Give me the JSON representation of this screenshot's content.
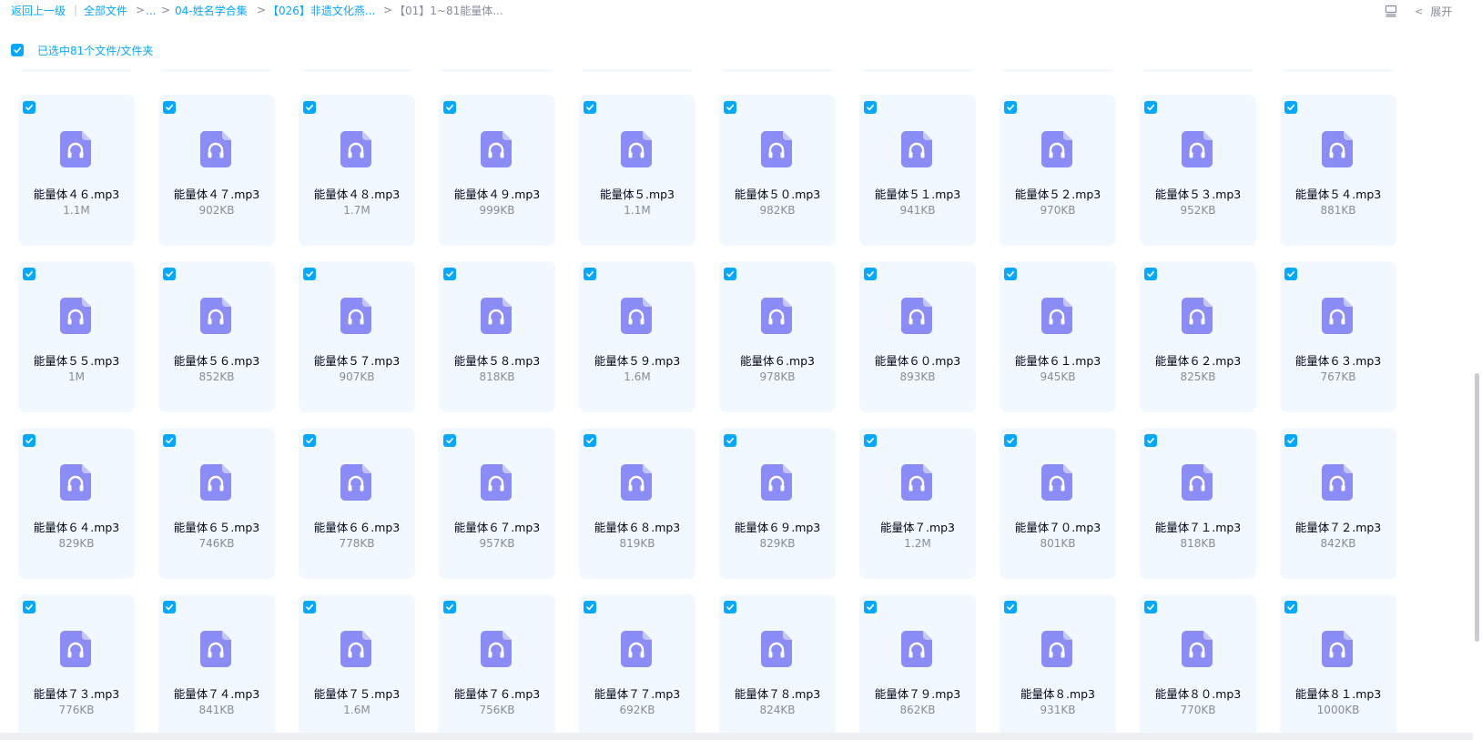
{
  "colors": {
    "accent": "#06a7ff",
    "icon": "#8b8cf6",
    "card": "#f1f8ff"
  },
  "breadcrumb": {
    "back": "返回上一级",
    "items": [
      "全部文件",
      "...",
      "04-姓名学合集",
      "【026】非遗文化燕...",
      "【01】1~81能量体..."
    ]
  },
  "toolbar": {
    "list_icon": "list-view-icon",
    "expand_label": "展开"
  },
  "selection": {
    "checked": true,
    "text": "已选中81个文件/文件夹"
  },
  "files": [
    {
      "name": "能量体４６.mp3",
      "size": "1.1M"
    },
    {
      "name": "能量体４７.mp3",
      "size": "902KB"
    },
    {
      "name": "能量体４８.mp3",
      "size": "1.7M"
    },
    {
      "name": "能量体４９.mp3",
      "size": "999KB"
    },
    {
      "name": "能量体５.mp3",
      "size": "1.1M"
    },
    {
      "name": "能量体５０.mp3",
      "size": "982KB"
    },
    {
      "name": "能量体５１.mp3",
      "size": "941KB"
    },
    {
      "name": "能量体５２.mp3",
      "size": "970KB"
    },
    {
      "name": "能量体５３.mp3",
      "size": "952KB"
    },
    {
      "name": "能量体５４.mp3",
      "size": "881KB"
    },
    {
      "name": "能量体５５.mp3",
      "size": "1M"
    },
    {
      "name": "能量体５６.mp3",
      "size": "852KB"
    },
    {
      "name": "能量体５７.mp3",
      "size": "907KB"
    },
    {
      "name": "能量体５８.mp3",
      "size": "818KB"
    },
    {
      "name": "能量体５９.mp3",
      "size": "1.6M"
    },
    {
      "name": "能量体６.mp3",
      "size": "978KB"
    },
    {
      "name": "能量体６０.mp3",
      "size": "893KB"
    },
    {
      "name": "能量体６１.mp3",
      "size": "945KB"
    },
    {
      "name": "能量体６２.mp3",
      "size": "825KB"
    },
    {
      "name": "能量体６３.mp3",
      "size": "767KB"
    },
    {
      "name": "能量体６４.mp3",
      "size": "829KB"
    },
    {
      "name": "能量体６５.mp3",
      "size": "746KB"
    },
    {
      "name": "能量体６６.mp3",
      "size": "778KB"
    },
    {
      "name": "能量体６７.mp3",
      "size": "957KB"
    },
    {
      "name": "能量体６８.mp3",
      "size": "819KB"
    },
    {
      "name": "能量体６９.mp3",
      "size": "829KB"
    },
    {
      "name": "能量体７.mp3",
      "size": "1.2M"
    },
    {
      "name": "能量体７０.mp3",
      "size": "801KB"
    },
    {
      "name": "能量体７１.mp3",
      "size": "818KB"
    },
    {
      "name": "能量体７２.mp3",
      "size": "842KB"
    },
    {
      "name": "能量体７３.mp3",
      "size": "776KB"
    },
    {
      "name": "能量体７４.mp3",
      "size": "841KB"
    },
    {
      "name": "能量体７５.mp3",
      "size": "1.6M"
    },
    {
      "name": "能量体７６.mp3",
      "size": "756KB"
    },
    {
      "name": "能量体７７.mp3",
      "size": "692KB"
    },
    {
      "name": "能量体７８.mp3",
      "size": "824KB"
    },
    {
      "name": "能量体７９.mp3",
      "size": "862KB"
    },
    {
      "name": "能量体８.mp3",
      "size": "931KB"
    },
    {
      "name": "能量体８０.mp3",
      "size": "770KB"
    },
    {
      "name": "能量体８１.mp3",
      "size": "1000KB"
    }
  ]
}
